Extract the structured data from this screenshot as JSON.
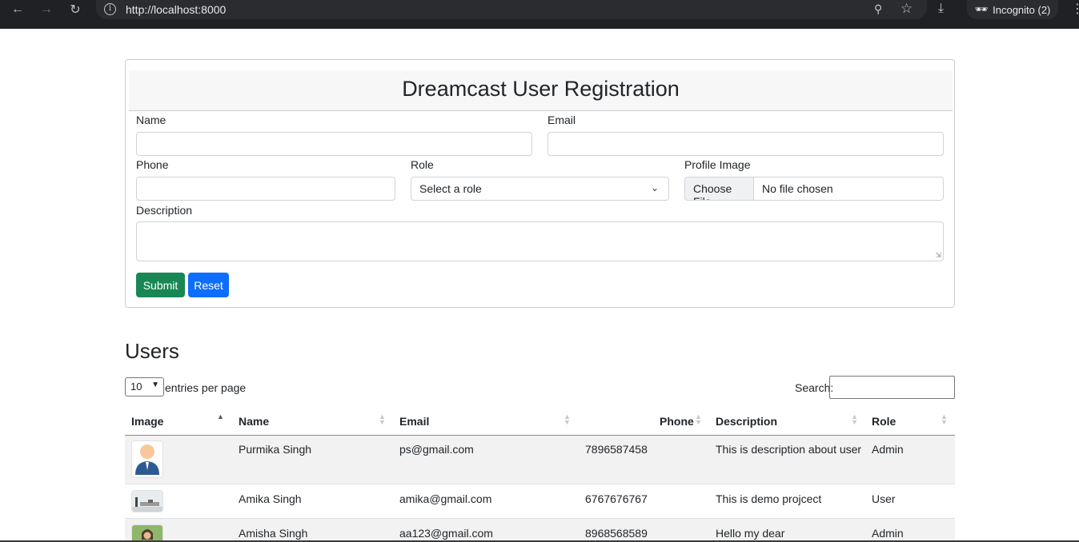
{
  "browser": {
    "url": "http://localhost:8000",
    "incognito_label": "Incognito (2)"
  },
  "form": {
    "title": "Dreamcast User Registration",
    "name_label": "Name",
    "email_label": "Email",
    "phone_label": "Phone",
    "role_label": "Role",
    "role_selected": "Select a role",
    "profile_label": "Profile Image",
    "choose_file": "Choose File",
    "no_file": "No file chosen",
    "description_label": "Description",
    "submit_label": "Submit",
    "reset_label": "Reset"
  },
  "users": {
    "title": "Users",
    "entries_value": "10",
    "entries_text": "entries per page",
    "search_label": "Search:",
    "columns": [
      "Image",
      "Name",
      "Email",
      "Phone",
      "Description",
      "Role"
    ],
    "rows": [
      {
        "name": "Purmika Singh",
        "email": "ps@gmail.com",
        "phone": "7896587458",
        "description": "This is description about user",
        "role": "Admin",
        "image": "avatar-icon"
      },
      {
        "name": "Amika Singh",
        "email": "amika@gmail.com",
        "phone": "6767676767",
        "description": "This is demo projcect",
        "role": "User",
        "image": "photo-thumbnail"
      },
      {
        "name": "Amisha Singh",
        "email": "aa123@gmail.com",
        "phone": "8968568589",
        "description": "Hello my dear",
        "role": "Admin",
        "image": "photo-thumbnail"
      }
    ]
  },
  "colors": {
    "submit": "#198754",
    "reset": "#0d6efd",
    "chrome": "#202124"
  }
}
